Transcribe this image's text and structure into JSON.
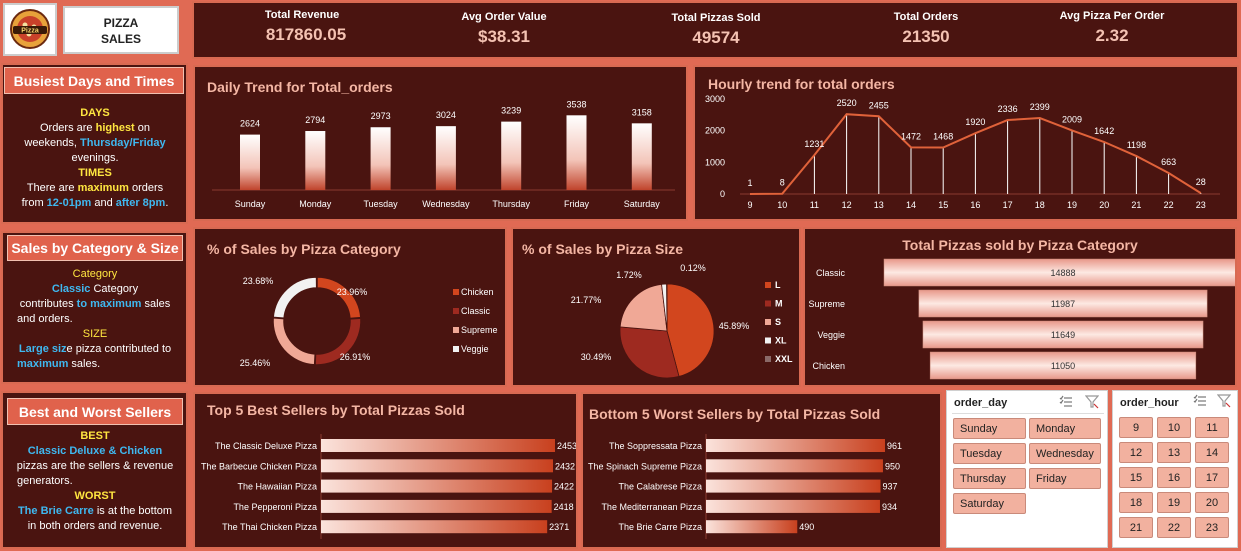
{
  "logo": {
    "text": "Pizza",
    "alt": "pizza-logo"
  },
  "brand": {
    "line1": "PIZZA",
    "line2": "SALES"
  },
  "kpis": [
    {
      "label": "Total Revenue",
      "value": "817860.05"
    },
    {
      "label": "Avg Order Value",
      "value": "$38.31"
    },
    {
      "label": "Total Pizzas Sold",
      "value": "49574"
    },
    {
      "label": "Total Orders",
      "value": "21350"
    },
    {
      "label": "Avg Pizza Per Order",
      "value": "2.32"
    }
  ],
  "busiest": {
    "heading": "Busiest Days and Times",
    "days_title": "DAYS",
    "days_l1a": "Orders are ",
    "days_l1b": "highest",
    "days_l1c": " on",
    "days_l2a": "weekends, ",
    "days_l2b": "Thursday/Friday",
    "days_l3": "evenings.",
    "times_title": "TIMES",
    "times_l1a": "There are ",
    "times_l1b": "maximum",
    "times_l1c": " orders",
    "times_l2a": "from ",
    "times_l2b": "12-01pm",
    "times_l2c": " and ",
    "times_l2d": "after 8pm",
    "times_l2e": "."
  },
  "catsize": {
    "heading": "Sales by Category & Size",
    "cat_title": "Category",
    "cat_l1a": "Classic",
    "cat_l1b": " Category",
    "cat_l2a": "contributes ",
    "cat_l2b": "to maximum",
    "cat_l2c": " sales",
    "cat_l3": "and orders.",
    "size_title": "SIZE",
    "size_l1a": "Large siz",
    "size_l1b": "e pizza contributed to",
    "size_l2a": "maximum",
    "size_l2b": " sales."
  },
  "bestworst": {
    "heading": "Best and Worst Sellers",
    "best_title": "BEST",
    "best_l1": "Classic Deluxe & Chicken",
    "best_l2": "pizzas are the sellers & revenue",
    "best_l3": "generators.",
    "worst_title": "WORST",
    "worst_l1a": "The Brie Carre",
    "worst_l1b": " is at the bottom",
    "worst_l2": "in both orders and revenue."
  },
  "colors": {
    "accent": "#e0624c",
    "panel": "#4a1410",
    "title": "#f4b6a4",
    "chicken": "#d2461e",
    "classic": "#9e2a20",
    "supreme": "#f0a896",
    "veggie": "#f2f2f2",
    "xxl": "#8a6a68"
  },
  "daily": {
    "title": "Daily Trend for Total_orders",
    "chart_data": {
      "type": "bar",
      "categories": [
        "Sunday",
        "Monday",
        "Tuesday",
        "Wednesday",
        "Thursday",
        "Friday",
        "Saturday"
      ],
      "values": [
        2624,
        2794,
        2973,
        3024,
        3239,
        3538,
        3158
      ]
    }
  },
  "hourly": {
    "title": "Hourly trend for total orders",
    "chart_data": {
      "type": "line",
      "x": [
        "9",
        "10",
        "11",
        "12",
        "13",
        "14",
        "15",
        "16",
        "17",
        "18",
        "19",
        "20",
        "21",
        "22",
        "23"
      ],
      "values": [
        1,
        8,
        1231,
        2520,
        2455,
        1472,
        1468,
        1920,
        2336,
        2399,
        2009,
        1642,
        1198,
        663,
        28
      ],
      "yticks": [
        "0",
        "1000",
        "2000",
        "3000"
      ],
      "ylim": [
        0,
        3000
      ]
    }
  },
  "category_pie": {
    "title": "% of Sales by Pizza Category",
    "chart_data": {
      "type": "pie",
      "labels": [
        "Chicken",
        "Classic",
        "Supreme",
        "Veggie"
      ],
      "values": [
        23.96,
        26.91,
        25.46,
        23.68
      ],
      "value_labels": [
        "23.96%",
        "26.91%",
        "25.46%",
        "23.68%"
      ]
    }
  },
  "size_pie": {
    "title": "% of Sales by Pizza Size",
    "chart_data": {
      "type": "pie",
      "labels": [
        "L",
        "M",
        "S",
        "XL",
        "XXL"
      ],
      "values": [
        45.89,
        30.49,
        21.77,
        1.72,
        0.12
      ],
      "value_labels": [
        "45.89%",
        "30.49%",
        "21.77%",
        "1.72%",
        "0.12%"
      ]
    }
  },
  "cat_total": {
    "title": "Total Pizzas sold by Pizza Category",
    "chart_data": {
      "type": "bar",
      "categories": [
        "Classic",
        "Supreme",
        "Veggie",
        "Chicken"
      ],
      "values": [
        14888,
        11987,
        11649,
        11050
      ]
    }
  },
  "top5": {
    "title": "Top 5 Best Sellers by Total Pizzas Sold",
    "chart_data": {
      "type": "bar",
      "categories": [
        "The Classic Deluxe Pizza",
        "The Barbecue Chicken Pizza",
        "The Hawaiian Pizza",
        "The Pepperoni Pizza",
        "The Thai Chicken Pizza"
      ],
      "values": [
        2453,
        2432,
        2422,
        2418,
        2371
      ]
    }
  },
  "bottom5": {
    "title": "Bottom 5 Worst Sellers by Total Pizzas Sold",
    "chart_data": {
      "type": "bar",
      "categories": [
        "The Soppressata Pizza",
        "The Spinach Supreme Pizza",
        "The Calabrese Pizza",
        "The Mediterranean Pizza",
        "The Brie Carre Pizza"
      ],
      "values": [
        961,
        950,
        937,
        934,
        490
      ]
    }
  },
  "slicer_day": {
    "title": "order_day",
    "items": [
      "Sunday",
      "Monday",
      "Tuesday",
      "Wednesday",
      "Thursday",
      "Friday",
      "Saturday"
    ]
  },
  "slicer_hour": {
    "title": "order_hour",
    "items": [
      "9",
      "10",
      "11",
      "12",
      "13",
      "14",
      "15",
      "16",
      "17",
      "18",
      "19",
      "20",
      "21",
      "22",
      "23"
    ]
  }
}
